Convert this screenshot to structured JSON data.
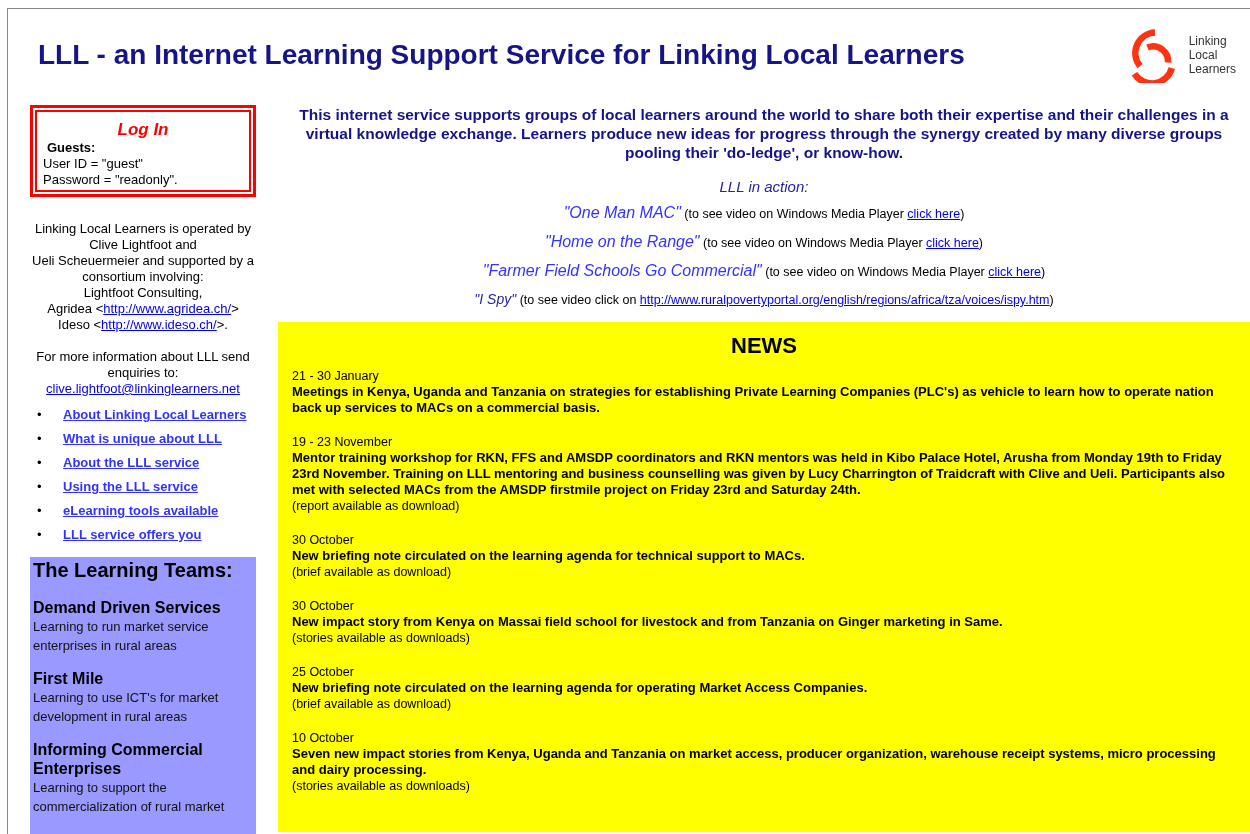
{
  "header": {
    "title": "LLL - an Internet Learning Support Service for Linking Local Learners",
    "logo_text": [
      "Linking",
      "Local",
      "Learners"
    ]
  },
  "login": {
    "title": "Log In",
    "guests_label": "Guests:",
    "lines": [
      "User ID = \"guest\"",
      "Password = \"readonly\"."
    ]
  },
  "operator_note": [
    [
      {
        "text": "Linking Local Learners is operated by"
      }
    ],
    [
      {
        "text": "Clive Lightfoot and"
      }
    ],
    [
      {
        "text": "Ueli Scheuermeier and supported by a consortium involving:"
      }
    ],
    [
      {
        "text": "Lightfoot Consulting,"
      }
    ],
    [
      {
        "text": "Agridea <"
      },
      {
        "link": "http://www.agridea.ch/"
      },
      {
        "text": ">"
      }
    ],
    [
      {
        "text": "Ideso <"
      },
      {
        "link": "http://www.ideso.ch/"
      },
      {
        "text": ">."
      }
    ]
  ],
  "contact": {
    "text": "For more information about LLL send enquiries to:",
    "email": "clive.lightfoot@linkinglearners.net"
  },
  "nav_links": [
    {
      "bullet": "•",
      "label": "About Linking Local Learners"
    },
    {
      "bullet": "•",
      "label": "What is unique about LLL"
    },
    {
      "bullet": "•",
      "label": "About the LLL service"
    },
    {
      "bullet": "•",
      "label": "Using the LLL service"
    },
    {
      "bullet": "•",
      "label": "eLearning tools available"
    },
    {
      "bullet": "•",
      "label": "LLL service offers you"
    }
  ],
  "learning_teams": {
    "heading": "The Learning Teams:",
    "teams": [
      {
        "name": "Demand Driven Services",
        "description": "Learning to run market service enterprises in rural areas"
      },
      {
        "name": "First Mile",
        "description": "Learning to use ICT's for market development in rural areas"
      },
      {
        "name": "Informing Commercial Enterprises",
        "description": "Learning to support the commercialization of rural market"
      }
    ]
  },
  "intro": "This internet service supports groups of local learners around the world to share both their expertise and their challenges in a virtual knowledge exchange. Learners produce new ideas for progress through the synergy created by many diverse groups pooling their 'do-ledge', or know-how.",
  "videos": {
    "heading": "LLL in action:",
    "items": [
      {
        "title": "\"One Man MAC\"",
        "before": "(to see video on Windows Media Player ",
        "link": "click here",
        "after": ")",
        "kind": "player"
      },
      {
        "title": "\"Home on the Range\"",
        "before": "(to see video on Windows Media Player ",
        "link": "click here",
        "after": ")",
        "kind": "player"
      },
      {
        "title": "\"Farmer Field Schools Go Commercial\"",
        "before": "(to see video on Windows Media Player ",
        "link": "click here",
        "after": ")",
        "kind": "player"
      },
      {
        "title": "\"I Spy\"",
        "before": "(to see video click on ",
        "link": "http://www.ruralpovertyportal.org/english/regions/africa/tza/voices/ispy.htm",
        "after": ")",
        "kind": "web"
      }
    ]
  },
  "news": {
    "heading": "NEWS",
    "items": [
      {
        "date": "21 - 30 January",
        "headline": "Meetings in Kenya, Uganda and Tanzania on strategies for establishing Private Learning Companies (PLC's) as vehicle to learn how to operate nation back up services to MACs on a commercial basis."
      },
      {
        "date": "19 - 23 November",
        "headline": "Mentor training workshop for RKN, FFS and AMSDP coordinators and RKN mentors was held in Kibo Palace Hotel, Arusha from Monday 19th to Friday 23rd November. Training on LLL mentoring and business counselling was given by Lucy Charrington of Traidcraft with Clive and Ueli. Participants also met with selected MACs from the AMSDP firstmile project on Friday 23rd and Saturday 24th.",
        "note": "(report available as download)"
      },
      {
        "date": "30 October",
        "headline": "New briefing note circulated on the learning agenda for technical support to MACs.",
        "note": "(brief available as download)"
      },
      {
        "date": "30 October",
        "headline": "New impact story from Kenya on Massai field school for livestock and from Tanzania on Ginger marketing in Same.",
        "note": "(stories available as downloads)"
      },
      {
        "date": "25 October",
        "headline": "New briefing note circulated on the learning agenda for operating Market Access Companies.",
        "note": "(brief available as download)"
      },
      {
        "date": "10 October",
        "headline": "Seven new impact stories from Kenya, Uganda and Tanzania on market access, producer organization, warehouse receipt systems, micro processing and dairy processing.",
        "note": "(stories available as downloads)"
      }
    ]
  }
}
